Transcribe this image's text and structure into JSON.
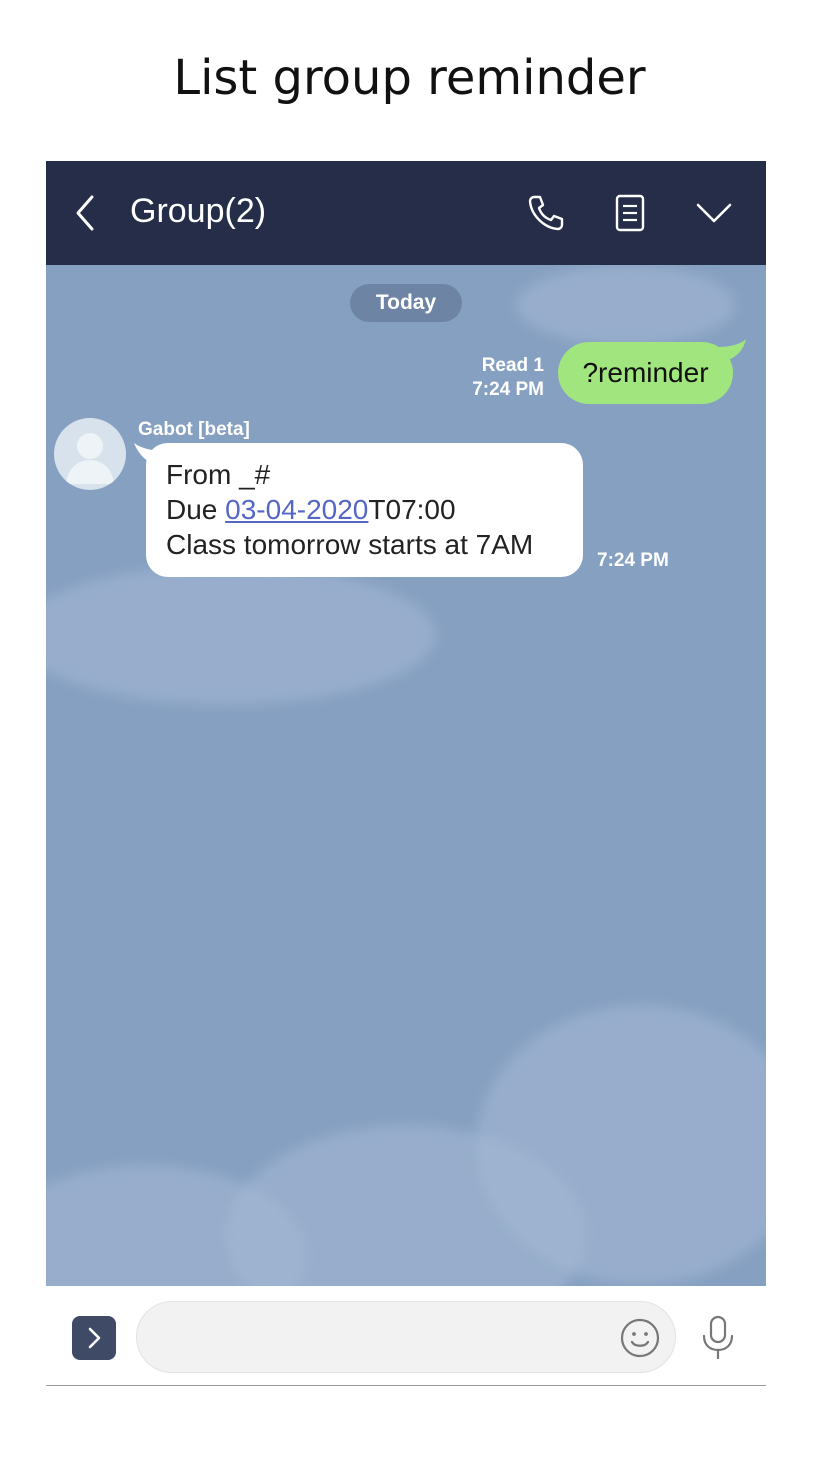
{
  "page": {
    "title": "List group reminder"
  },
  "header": {
    "title": "Group(2)"
  },
  "chat": {
    "date_label": "Today",
    "outgoing": {
      "read_status": "Read 1",
      "time": "7:24 PM",
      "text": "?reminder"
    },
    "incoming": {
      "sender": "Gabot [beta]",
      "line1": "From _#",
      "due_prefix": "Due ",
      "due_date": "03-04-2020",
      "due_time": "T07:00",
      "line3": "Class tomorrow starts at 7AM",
      "time": "7:24 PM"
    }
  },
  "input": {
    "placeholder": "",
    "value": ""
  },
  "colors": {
    "header_bg": "#252d48",
    "chat_bg": "#86a0c1",
    "outgoing_bubble": "#a0e57e",
    "incoming_bubble": "#ffffff",
    "link": "#5567c4"
  },
  "icons": {
    "back": "chevron-left-icon",
    "call": "phone-icon",
    "notes": "notes-icon",
    "menu": "chevron-down-icon",
    "expand": "chevron-right-icon",
    "emoji": "smiley-icon",
    "mic": "microphone-icon"
  }
}
